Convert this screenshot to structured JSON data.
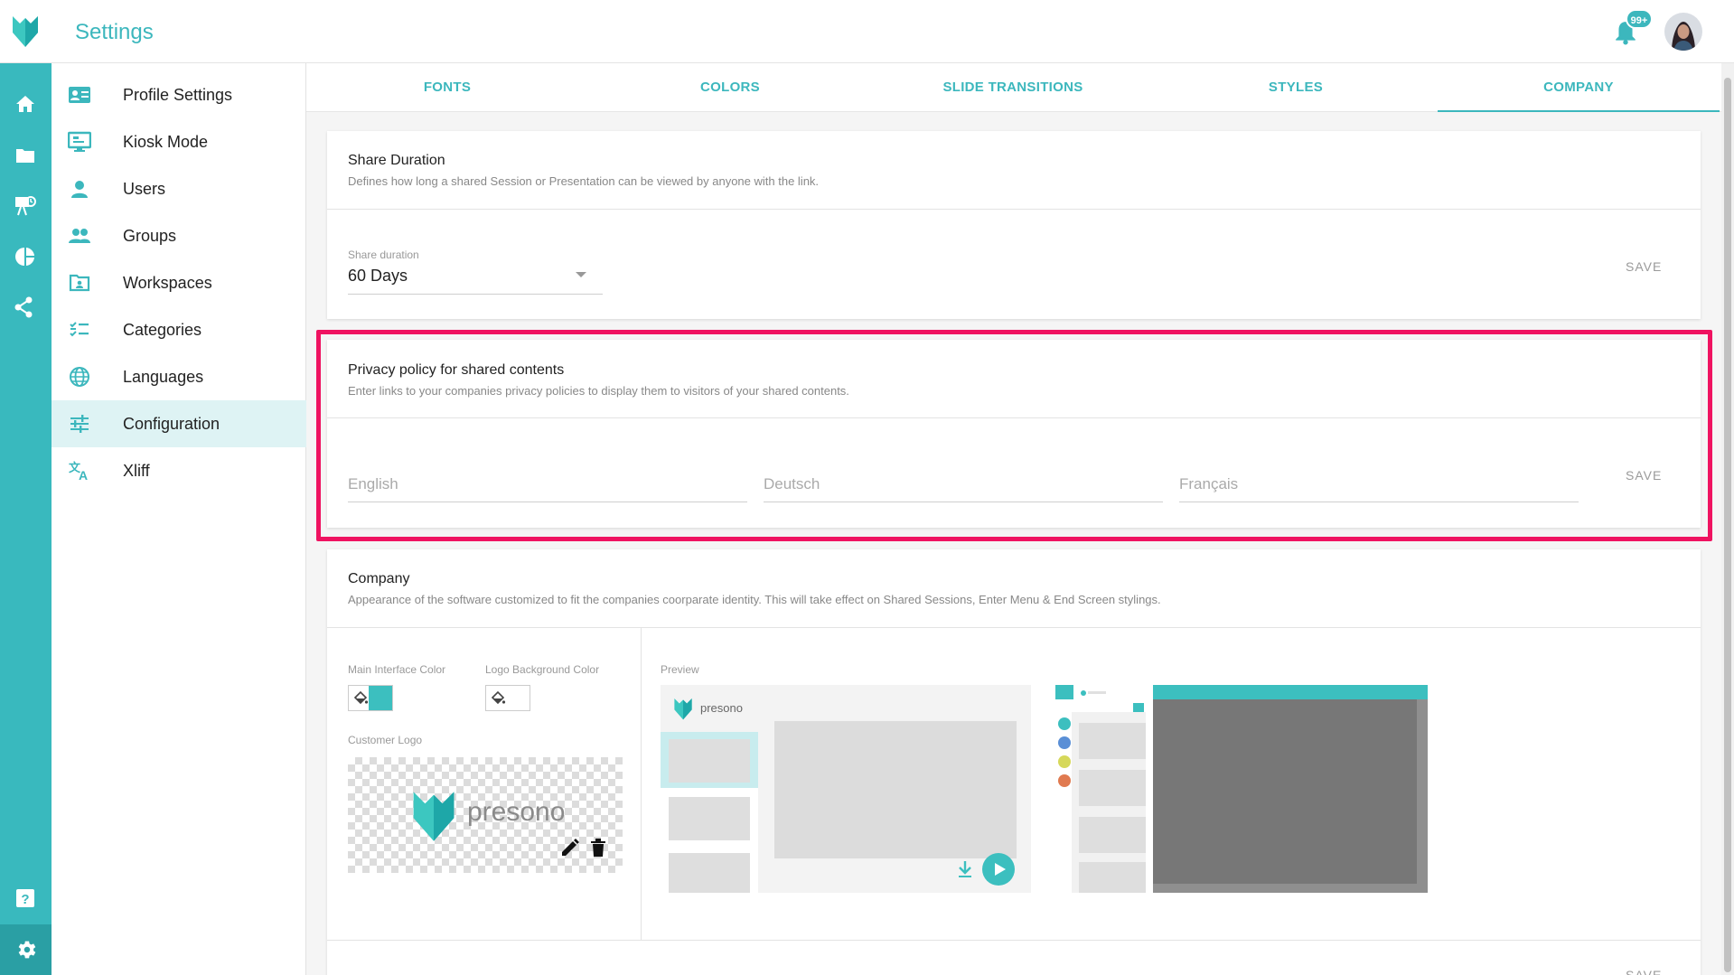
{
  "header": {
    "title": "Settings",
    "notification_badge": "99+"
  },
  "rail": {
    "items": [
      "home-icon",
      "folder-icon",
      "presentation-icon",
      "pie-chart-icon",
      "share-icon"
    ],
    "help_icon": "help-icon",
    "settings_icon": "gear-icon"
  },
  "sidebar": {
    "items": [
      {
        "label": "Profile Settings",
        "icon": "profile-card-icon"
      },
      {
        "label": "Kiosk Mode",
        "icon": "kiosk-icon"
      },
      {
        "label": "Users",
        "icon": "user-icon"
      },
      {
        "label": "Groups",
        "icon": "group-icon"
      },
      {
        "label": "Workspaces",
        "icon": "workspace-icon"
      },
      {
        "label": "Categories",
        "icon": "categories-icon"
      },
      {
        "label": "Languages",
        "icon": "globe-icon"
      },
      {
        "label": "Configuration",
        "icon": "sliders-icon",
        "active": true
      },
      {
        "label": "Xliff",
        "icon": "translate-icon"
      }
    ]
  },
  "tabs": [
    {
      "label": "FONTS"
    },
    {
      "label": "COLORS"
    },
    {
      "label": "SLIDE TRANSITIONS"
    },
    {
      "label": "STYLES"
    },
    {
      "label": "COMPANY",
      "active": true
    }
  ],
  "share_duration": {
    "title": "Share Duration",
    "description": "Defines how long a shared Session or Presentation can be viewed by anyone with the link.",
    "field_label": "Share duration",
    "value": "60 Days",
    "save_label": "SAVE"
  },
  "privacy": {
    "title": "Privacy policy for shared contents",
    "description": "Enter links to your companies privacy policies to display them to visitors of your shared contents.",
    "fields": [
      {
        "placeholder": "English",
        "value": ""
      },
      {
        "placeholder": "Deutsch",
        "value": ""
      },
      {
        "placeholder": "Français",
        "value": ""
      }
    ],
    "save_label": "SAVE"
  },
  "company": {
    "title": "Company",
    "description": "Appearance of the software customized to fit the companies coorparate identity. This will take effect on Shared Sessions, Enter Menu & End Screen stylings.",
    "main_color_label": "Main Interface Color",
    "main_color": "#3cbfbf",
    "logo_bg_label": "Logo Background Color",
    "logo_bg_color": "#ffffff",
    "customer_logo_label": "Customer Logo",
    "logo_text": "presono",
    "preview_label": "Preview",
    "preview_logo_text": "presono",
    "save_label": "SAVE"
  },
  "colors": {
    "accent": "#3cb7bd",
    "rail": "#39b9be",
    "highlight": "#ef1361"
  }
}
